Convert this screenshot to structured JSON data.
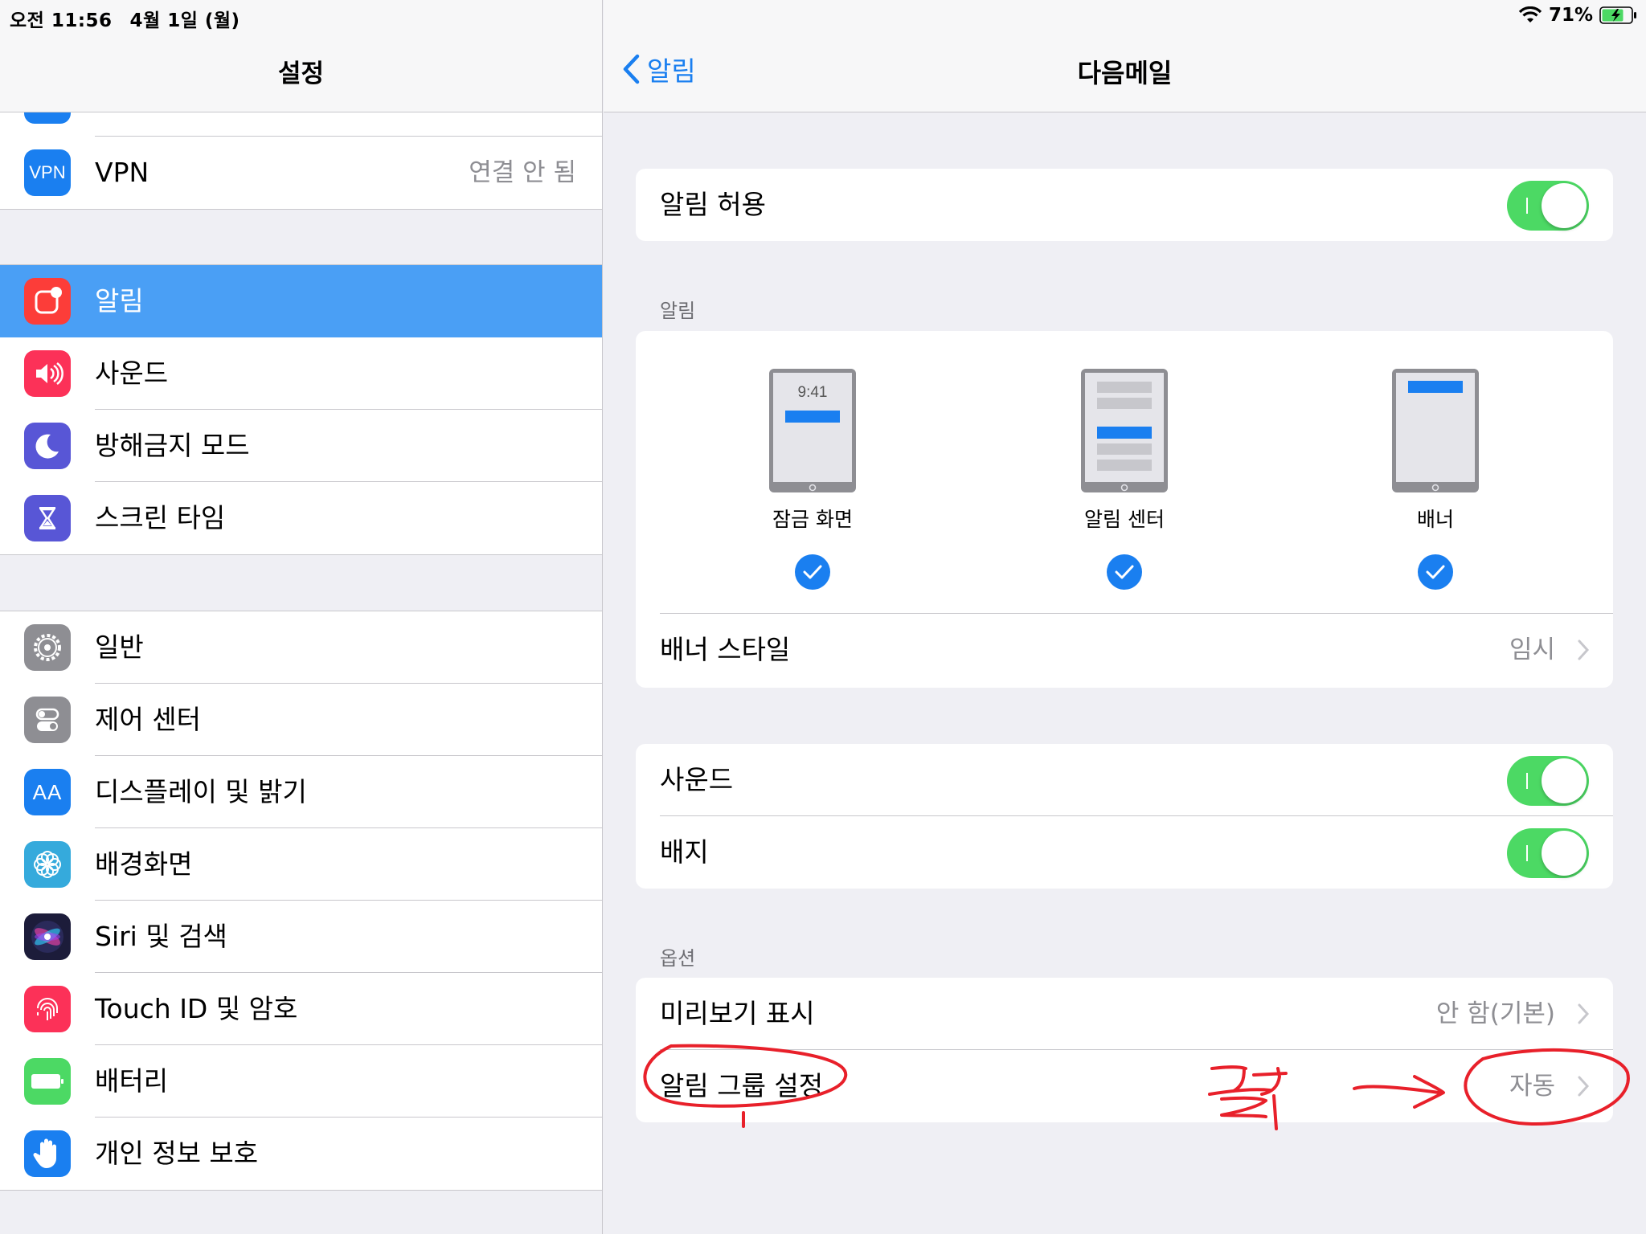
{
  "status_bar": {
    "time": "오전 11:56",
    "date": "4월 1일 (월)",
    "battery_percent": "71%",
    "wifi_icon": "wifi-icon",
    "battery_icon": "battery-charging-icon"
  },
  "sidebar": {
    "title": "설정",
    "vpn": {
      "label": "VPN",
      "icon_text": "VPN",
      "value": "연결 안 됨",
      "color": "#1a7ff0"
    },
    "group2": [
      {
        "label": "알림",
        "icon": "notifications-icon",
        "color": "#fc3d39",
        "selected": true
      },
      {
        "label": "사운드",
        "icon": "sound-icon",
        "color": "#fc3158"
      },
      {
        "label": "방해금지 모드",
        "icon": "moon-icon",
        "color": "#5856d6"
      },
      {
        "label": "스크린 타임",
        "icon": "hourglass-icon",
        "color": "#5856d6"
      }
    ],
    "group3": [
      {
        "label": "일반",
        "icon": "gear-icon",
        "color": "#8e8e93"
      },
      {
        "label": "제어 센터",
        "icon": "toggles-icon",
        "color": "#8e8e93"
      },
      {
        "label": "디스플레이 및 밝기",
        "icon": "display-icon",
        "icon_text": "AA",
        "color": "#1a7ff0"
      },
      {
        "label": "배경화면",
        "icon": "flower-icon",
        "color": "#35aadc"
      },
      {
        "label": "Siri 및 검색",
        "icon": "siri-icon",
        "color": "#1c1c3a"
      },
      {
        "label": "Touch ID 및 암호",
        "icon": "fingerprint-icon",
        "color": "#fc3158"
      },
      {
        "label": "배터리",
        "icon": "battery-icon",
        "color": "#4cd964"
      },
      {
        "label": "개인 정보 보호",
        "icon": "hand-icon",
        "color": "#1a7ff0"
      }
    ]
  },
  "main": {
    "back_label": "알림",
    "title": "다음메일",
    "allow": {
      "label": "알림 허용",
      "on": true
    },
    "alerts_header": "알림",
    "styles": [
      {
        "label": "잠금 화면",
        "time_text": "9:41",
        "checked": true
      },
      {
        "label": "알림 센터",
        "checked": true
      },
      {
        "label": "배너",
        "checked": true
      }
    ],
    "banner_style": {
      "label": "배너 스타일",
      "value": "임시"
    },
    "sound": {
      "label": "사운드",
      "on": true
    },
    "badge": {
      "label": "배지",
      "on": true
    },
    "options_header": "옵션",
    "preview": {
      "label": "미리보기 표시",
      "value": "안 함(기본)"
    },
    "grouping": {
      "label": "알림 그룹 설정",
      "value": "자동"
    }
  },
  "colors": {
    "accent": "#1a7ff0",
    "selected_row": "#4a9ff5",
    "toggle_on": "#4cd964",
    "annotation": "#e8202a"
  }
}
